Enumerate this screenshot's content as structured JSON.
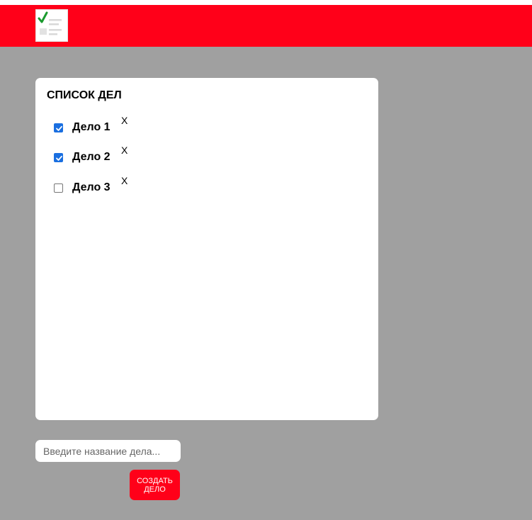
{
  "header": {
    "logo_icon": "todo-checklist-icon",
    "background_color": "#ff0019"
  },
  "todo": {
    "title": "СПИСОК ДЕЛ",
    "items": [
      {
        "label": "Дело 1",
        "checked": true,
        "remove_label": "X"
      },
      {
        "label": "Дело 2",
        "checked": true,
        "remove_label": "X"
      },
      {
        "label": "Дело 3",
        "checked": false,
        "remove_label": "X"
      }
    ]
  },
  "form": {
    "input_placeholder": "Введите название дела...",
    "input_value": "",
    "create_button_label": "СОЗДАТЬ ДЕЛО"
  },
  "colors": {
    "page_background": "#a0a0a0",
    "accent": "#ff0019",
    "checkbox_checked": "#1a6fe0"
  }
}
